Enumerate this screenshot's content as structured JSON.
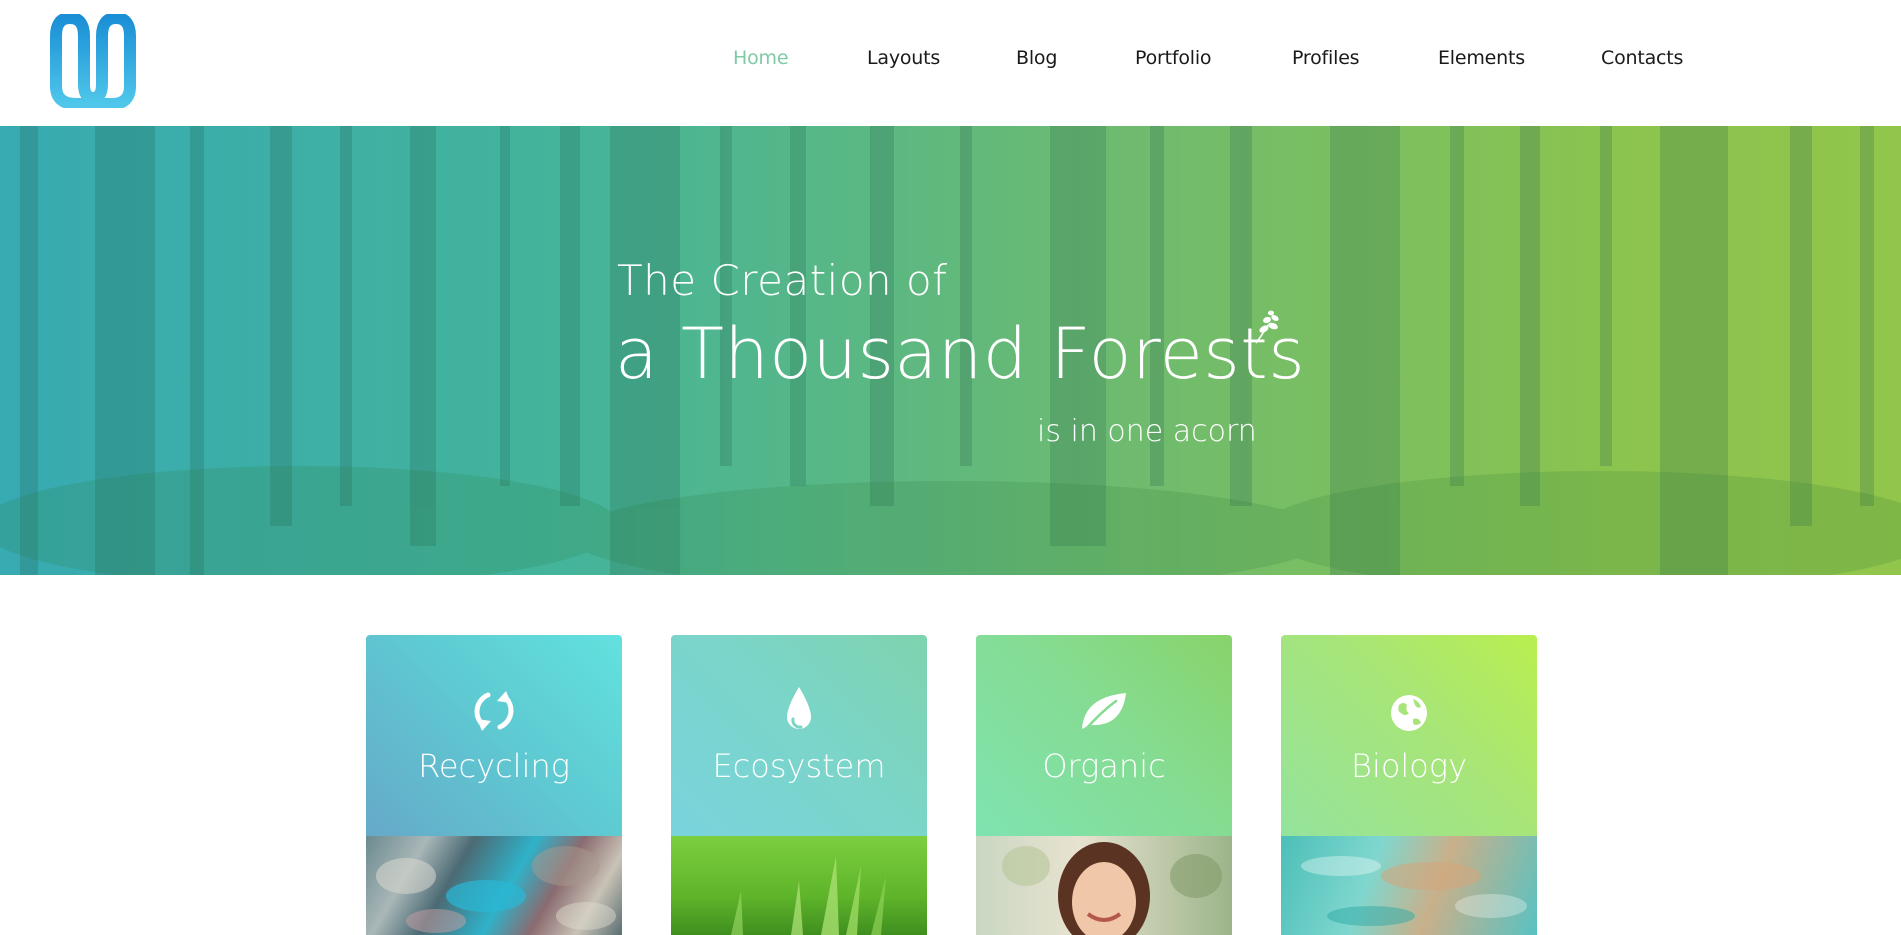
{
  "header": {
    "logo_icon": "m-logo-icon",
    "nav": [
      {
        "label": "Home",
        "active": true
      },
      {
        "label": "Layouts",
        "active": false
      },
      {
        "label": "Blog",
        "active": false
      },
      {
        "label": "Portfolio",
        "active": false
      },
      {
        "label": "Profiles",
        "active": false
      },
      {
        "label": "Elements",
        "active": false
      },
      {
        "label": "Contacts",
        "active": false
      }
    ],
    "active_color": "#7fcba6"
  },
  "hero": {
    "line1": "The Creation of",
    "line2": "a Thousand Forests",
    "line3": "is in one acorn",
    "decor_icon": "sprout-icon"
  },
  "features": [
    {
      "label": "Recycling",
      "icon": "recycle-icon",
      "photo": "crushed-cans-photo"
    },
    {
      "label": "Ecosystem",
      "icon": "water-drop-icon",
      "photo": "grass-photo"
    },
    {
      "label": "Organic",
      "icon": "leaf-icon",
      "photo": "smiling-girl-photo"
    },
    {
      "label": "Biology",
      "icon": "globe-icon",
      "photo": "swimmer-photo"
    }
  ]
}
